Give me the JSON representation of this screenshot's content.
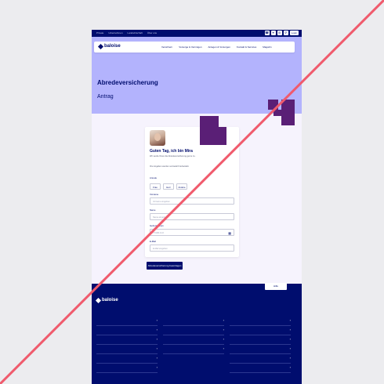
{
  "topbar": {
    "links": [
      "Private",
      "Unternehmen",
      "Landwirtschaft",
      "Über uns"
    ],
    "login_label": "Login"
  },
  "nav": {
    "logo_text": "baloise",
    "items": [
      "Versichern",
      "Vorsorge & Vermögen",
      "Anlegen & Vorsorgen",
      "Kontakt & Services",
      "Magazin"
    ]
  },
  "hero": {
    "title": "Abredeversicherung",
    "subtitle": "Antrag"
  },
  "form": {
    "greeting": "Guten Tag, ich bin Mira",
    "intro": "Wir sende Ihnen die Abredeversicherung gerne zu.",
    "intro2": "Ihre Angaben werden vertraulich behandelt.",
    "anrede_label": "Anrede",
    "anrede_options": [
      "Frau",
      "Herr",
      "Andere"
    ],
    "vorname_label": "Vorname",
    "vorname_placeholder": "Vorname eingeben",
    "name_label": "Name",
    "name_placeholder": "Name eingeben",
    "geburtsdatum_label": "Geburtsdatum",
    "geburtsdatum_placeholder": "TT.MM.JJJJ",
    "email_label": "E-Mail",
    "email_placeholder": "E-Mail eingeben",
    "submit_label": "Abredeversicherung beantragen"
  },
  "footer": {
    "help_label": "Hilfe"
  }
}
